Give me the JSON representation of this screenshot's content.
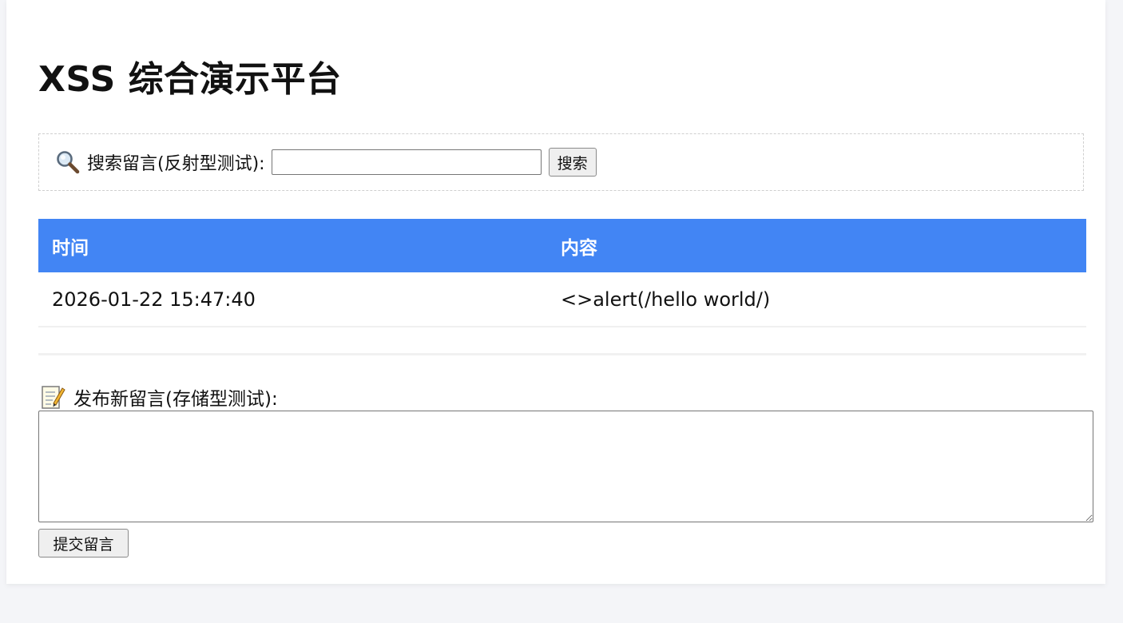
{
  "page": {
    "title": "XSS 综合演示平台"
  },
  "search": {
    "label": "搜索留言(反射型测试):",
    "value": "",
    "placeholder": "",
    "button_label": "搜索"
  },
  "table": {
    "headers": {
      "time": "时间",
      "content": "内容"
    },
    "rows": [
      {
        "time": "2026-01-22 15:47:40",
        "content": "<>alert(/hello world/)"
      }
    ]
  },
  "post": {
    "label": "发布新留言(存储型测试):",
    "textarea_value": "",
    "submit_label": "提交留言"
  },
  "colors": {
    "header_bg": "#4285f4",
    "header_text": "#ffffff"
  },
  "icons": {
    "search": "search-icon",
    "memo": "memo-icon"
  }
}
